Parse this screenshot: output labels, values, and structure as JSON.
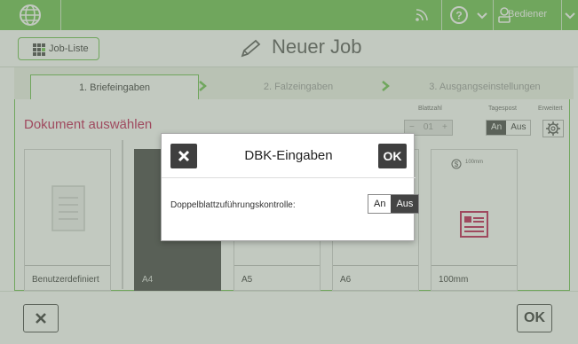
{
  "colors": {
    "brand_green": "#6abf4b",
    "accent_red": "#c0174e",
    "dark": "#3f3f3f"
  },
  "topbar": {
    "icons": [
      "globe-icon",
      "rss-icon",
      "help-icon",
      "chevron-down-icon",
      "user-icon",
      "chevron-down-icon"
    ],
    "user_label": "Bediener"
  },
  "header": {
    "joblist_label": "Job-Liste",
    "page_title": "Neuer Job"
  },
  "steps": {
    "items": [
      {
        "label": "1. Briefeingaben",
        "active": true
      },
      {
        "label": "2. Falzeingaben",
        "active": false
      },
      {
        "label": "3. Ausgangseinstellungen",
        "active": false
      }
    ]
  },
  "content": {
    "section_title": "Dokument auswählen",
    "blattzahl_label": "Blattzahl",
    "blattzahl_value": "01",
    "tagespost_label": "Tagespost",
    "tagespost_on": "An",
    "tagespost_off": "Aus",
    "erweitert_label": "Erweitert",
    "cards": [
      {
        "name": "Benutzerdefiniert"
      },
      {
        "name": "A4"
      },
      {
        "name": "A5"
      },
      {
        "name": "A6"
      },
      {
        "name": "100mm",
        "caption": "100mm"
      }
    ]
  },
  "dialog": {
    "title": "DBK-Eingaben",
    "ok_label": "OK",
    "field_label": "Doppelblattzuführungskontrolle:",
    "toggle_on": "An",
    "toggle_off": "Aus"
  },
  "bottom": {
    "ok_label": "OK"
  }
}
